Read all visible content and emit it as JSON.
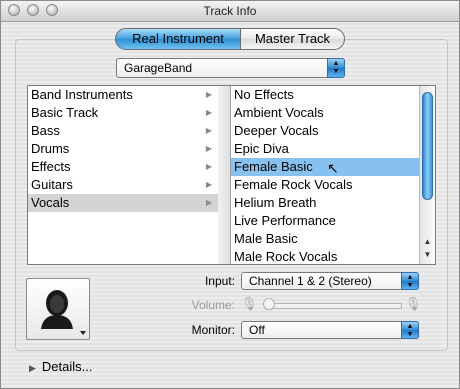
{
  "window": {
    "title": "Track Info"
  },
  "tabs": {
    "real_instrument": "Real Instrument",
    "master_track": "Master Track"
  },
  "library_popup": {
    "value": "GarageBand"
  },
  "categories": [
    "Band Instruments",
    "Basic Track",
    "Bass",
    "Drums",
    "Effects",
    "Guitars",
    "Vocals"
  ],
  "presets": [
    "No Effects",
    "Ambient Vocals",
    "Deeper Vocals",
    "Epic Diva",
    "Female Basic",
    "Female Rock Vocals",
    "Helium Breath",
    "Live Performance",
    "Male Basic",
    "Male Rock Vocals"
  ],
  "input": {
    "label": "Input:",
    "value": "Channel 1 & 2 (Stereo)"
  },
  "volume": {
    "label": "Volume:"
  },
  "monitor": {
    "label": "Monitor:",
    "value": "Off"
  },
  "details": {
    "label": "Details..."
  },
  "colors": {
    "accent": "#3f9fde",
    "selection": "#87c1ef",
    "selection_inactive": "#d4d4d4"
  }
}
